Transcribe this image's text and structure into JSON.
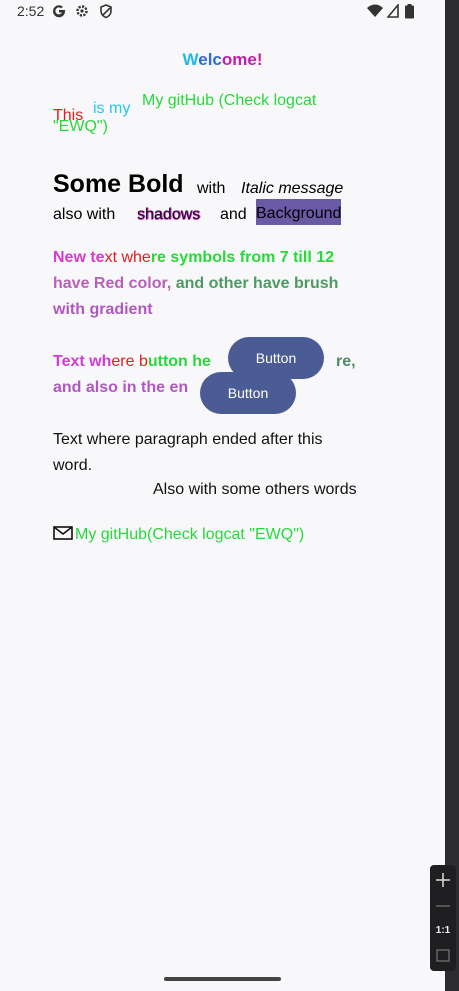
{
  "status_bar": {
    "time": "2:52",
    "left_icons": [
      "google-g-icon",
      "settings-gear-icon",
      "shield-icon"
    ],
    "right_icons": [
      "wifi-icon",
      "signal-icon",
      "battery-icon"
    ]
  },
  "welcome": {
    "part1": "W",
    "part2": "elc",
    "part3": "ome!"
  },
  "overlap_text": {
    "this": "This",
    "is_my": "is my",
    "github": "My gitHub (Check logcat",
    "ewq": "\"EWQ\")"
  },
  "rich": {
    "bold": "Some Bold",
    "with": "with",
    "italic": "Italic message",
    "also_with": "also with",
    "shadows": "shadows",
    "and": "and",
    "background": "Background"
  },
  "gradient_paragraph": {
    "line1": [
      "New te",
      "xt ",
      "whe",
      "re symbols from 7 till 12"
    ],
    "line2": [
      "have Red color, ",
      "and other have brush"
    ],
    "line3": [
      "with gradient"
    ]
  },
  "button_paragraph": {
    "line1a": "Text wh",
    "line1b": "ere b",
    "line1c": "utton he",
    "line1d": "re,",
    "line2a": "and also in the en",
    "button1": "Button",
    "button2": "Button"
  },
  "paragraph_text": {
    "line1": "Text where paragraph ended after this",
    "line2": "word.",
    "line3": "Also with some others words"
  },
  "mail_link": {
    "text": "My gitHub(Check logcat \"EWQ\")"
  },
  "zoom_controls": {
    "ratio": "1:1"
  },
  "colors": {
    "green": "#27d93a",
    "magenta": "#d63ad6",
    "red": "#e02020",
    "button_bg": "#4b5b93",
    "highlight_bg": "#6a5aa6"
  }
}
